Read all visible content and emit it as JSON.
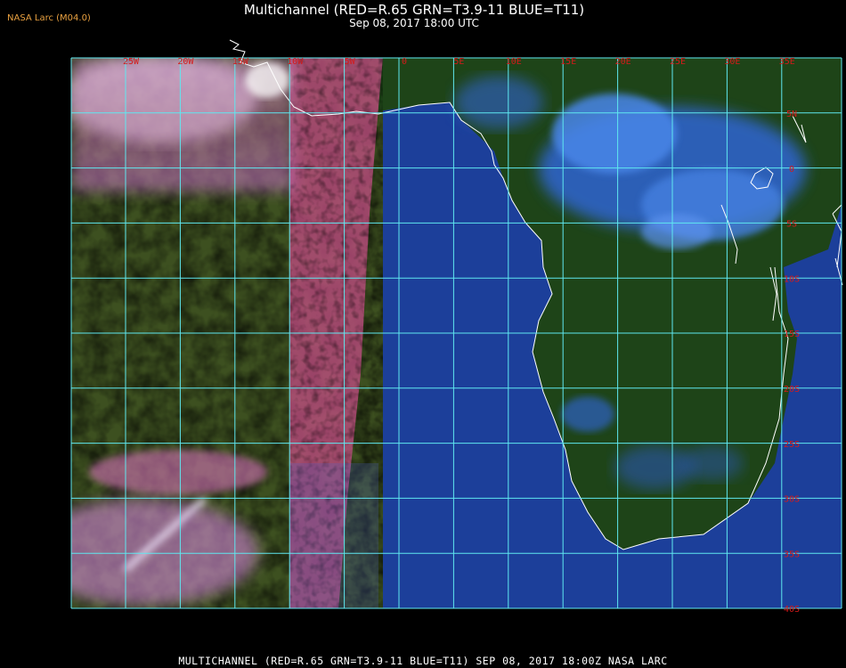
{
  "header": {
    "brand": "NASA Larc (M04.0)",
    "title": "Multichannel (RED=R.65 GRN=T3.9-11 BLUE=T11)",
    "subtitle": "Sep 08, 2017 18:00 UTC"
  },
  "footer": {
    "caption": "MULTICHANNEL (RED=R.65 GRN=T3.9-11 BLUE=T11) SEP 08, 2017 18:00Z  NASA LARC"
  },
  "map": {
    "lon_labels": [
      "25W",
      "20W",
      "15W",
      "10W",
      "5W",
      "0",
      "5E",
      "10E",
      "15E",
      "20E",
      "25E",
      "30E",
      "35E"
    ],
    "lat_labels": [
      "5N",
      "0",
      "5S",
      "10S",
      "15S",
      "20S",
      "25S",
      "30S",
      "35S",
      "40S"
    ],
    "colors": {
      "grid": "#5fe8f0",
      "label": "#d61a1a",
      "coast": "#ffffff",
      "ocean": "#1c3f9a",
      "land": "#1b3f14",
      "cloud_pink": "#dc6fc8",
      "cloud_blue": "#4c88ee"
    }
  }
}
